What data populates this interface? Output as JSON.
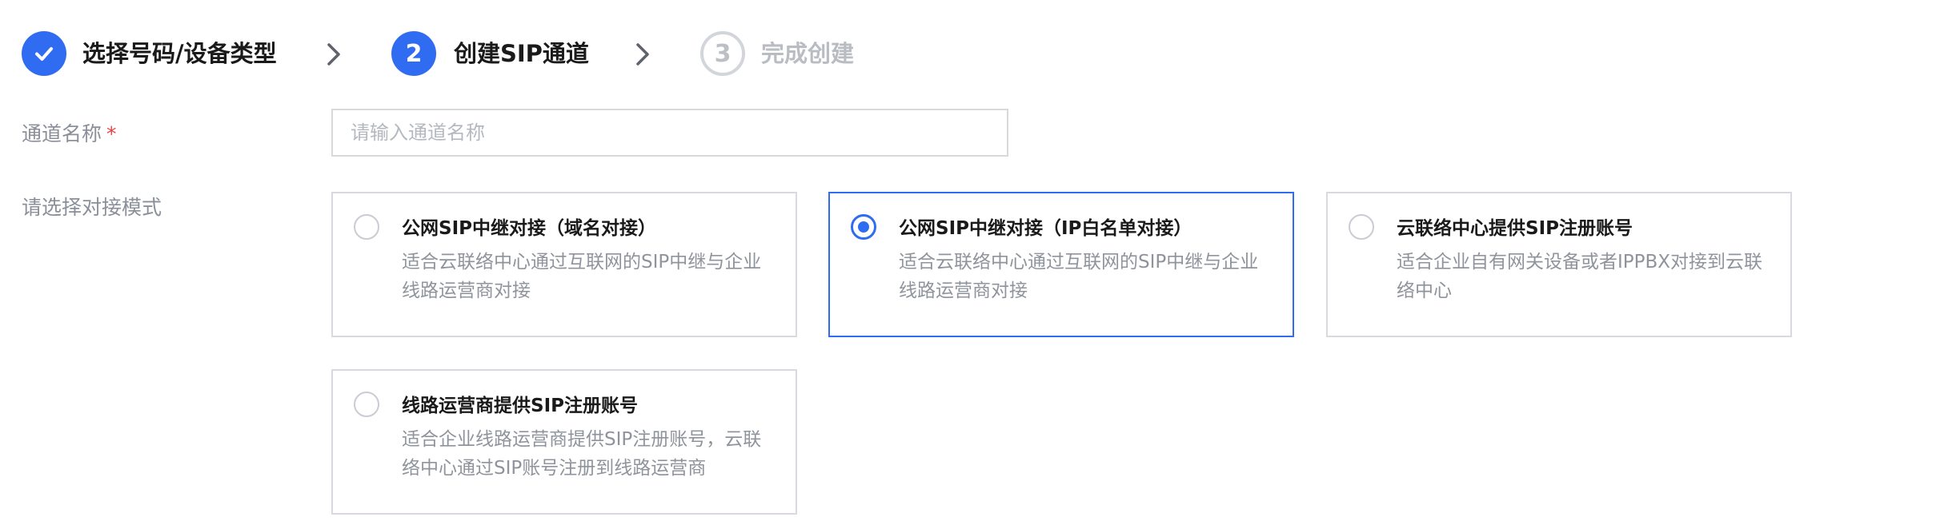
{
  "colors": {
    "primary": "#2f6cf2",
    "required": "#e54545",
    "border": "#d8dadf",
    "muted_text": "#8f949c"
  },
  "steps": [
    {
      "label": "选择号码/设备类型",
      "state": "done",
      "icon": "check-icon"
    },
    {
      "number": "2",
      "label": "创建SIP通道",
      "state": "active"
    },
    {
      "number": "3",
      "label": "完成创建",
      "state": "pending"
    }
  ],
  "form": {
    "channel_name": {
      "label": "通道名称",
      "required_mark": "*",
      "placeholder": "请输入通道名称",
      "value": ""
    },
    "mode": {
      "label": "请选择对接模式",
      "options": [
        {
          "title": "公网SIP中继对接（域名对接）",
          "description": "适合云联络中心通过互联网的SIP中继与企业线路运营商对接",
          "selected": false
        },
        {
          "title": "公网SIP中继对接（IP白名单对接）",
          "description": "适合云联络中心通过互联网的SIP中继与企业线路运营商对接",
          "selected": true
        },
        {
          "title": "云联络中心提供SIP注册账号",
          "description": "适合企业自有网关设备或者IPPBX对接到云联络中心",
          "selected": false
        },
        {
          "title": "线路运营商提供SIP注册账号",
          "description": "适合企业线路运营商提供SIP注册账号，云联络中心通过SIP账号注册到线路运营商",
          "selected": false
        }
      ]
    }
  }
}
